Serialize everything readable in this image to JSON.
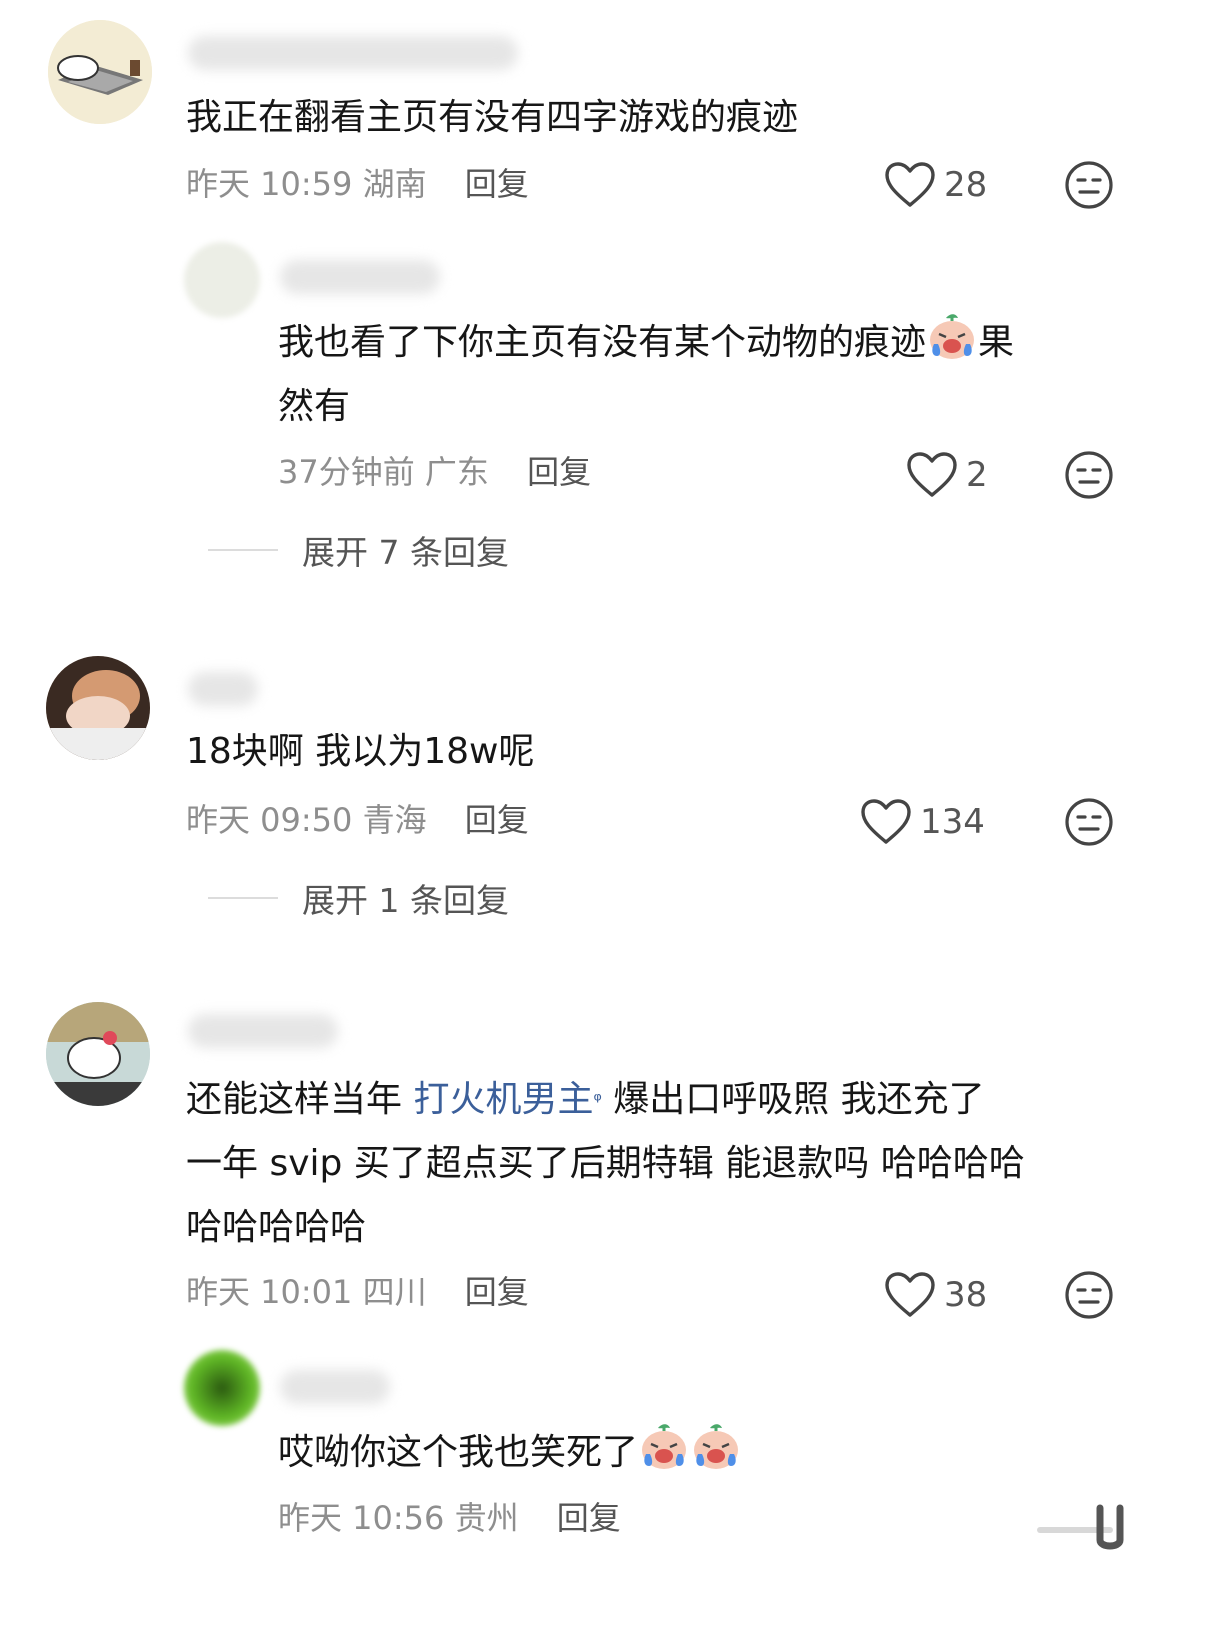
{
  "comments": [
    {
      "text": "我正在翻看主页有没有四字游戏的痕迹",
      "time": "昨天 10:59",
      "location": "湖南",
      "reply_label": "回复",
      "likes": "28",
      "replies": [
        {
          "text_a": "我也看了下你主页有没有某个动物的痕迹",
          "emoji": "crying-face-emoji",
          "text_b": "果",
          "text_c": "然有",
          "time": "37分钟前",
          "location": "广东",
          "reply_label": "回复",
          "likes": "2"
        }
      ],
      "expand_label": "展开 7 条回复"
    },
    {
      "text": "18块啊 我以为18w呢",
      "time": "昨天 09:50",
      "location": "青海",
      "reply_label": "回复",
      "likes": "134",
      "expand_label": "展开 1 条回复"
    },
    {
      "text_a": "还能这样当年 ",
      "link": "打火机男主",
      "text_b": " 爆出口呼吸照 我还充了",
      "text_c": "一年 svip 买了超点买了后期特辑 能退款吗 哈哈哈哈",
      "text_d": "哈哈哈哈哈",
      "time": "昨天 10:01",
      "location": "四川",
      "reply_label": "回复",
      "likes": "38",
      "replies": [
        {
          "text": "哎呦你这个我也笑死了",
          "emoji": "crying-face-emoji",
          "time": "昨天 10:56",
          "location": "贵州",
          "reply_label": "回复"
        }
      ]
    }
  ],
  "icons": {
    "like": "heart-outline-icon",
    "dislike": "meh-face-icon",
    "search": "search-icon"
  },
  "colors": {
    "text": "#161616",
    "meta": "#8e8e8e",
    "link": "#3b5f9a",
    "icon": "#444444"
  }
}
